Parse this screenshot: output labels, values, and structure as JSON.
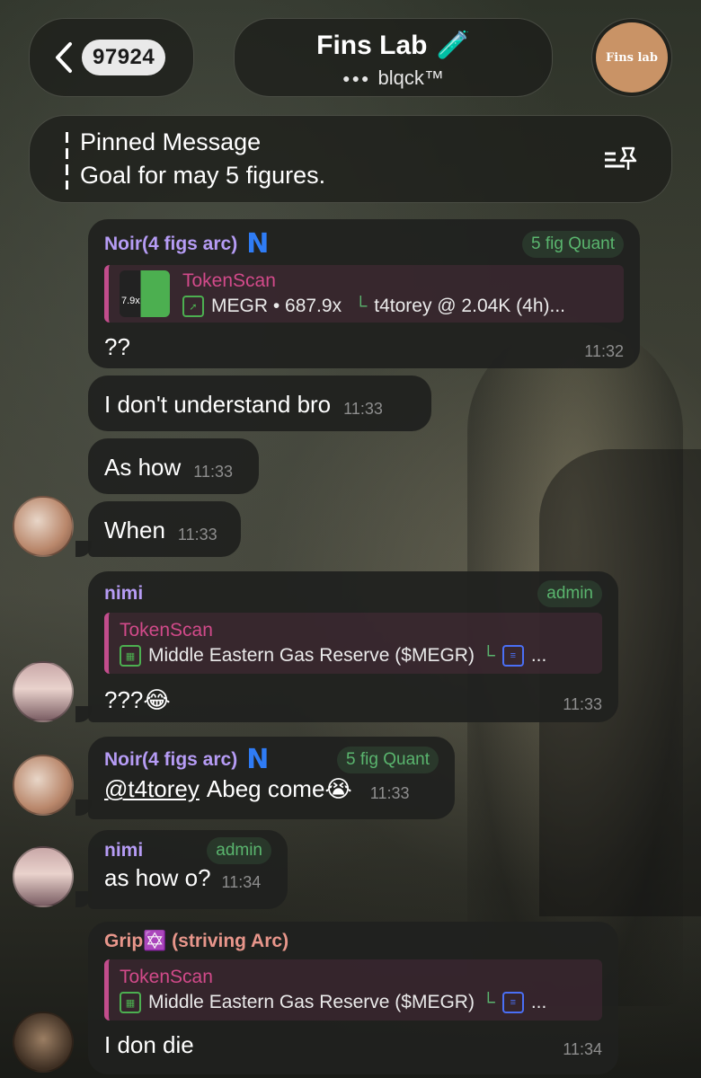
{
  "header": {
    "back_count": "97924",
    "title": "Fins Lab",
    "title_emoji": "🧪",
    "subtitle": "blqck™",
    "group_avatar_text": "Fins lab"
  },
  "pinned": {
    "title": "Pinned Message",
    "text": "Goal for may 5 figures."
  },
  "messages": [
    {
      "sender": "Noir(4 figs arc)",
      "tag": "5 fig Quant",
      "reply_title": "TokenScan",
      "reply_body": "MEGR • 687.9x",
      "reply_extra": "t4torey @ 2.04K (4h)...",
      "thumb_label": "7.9x",
      "text": "??",
      "time": "11:32"
    },
    {
      "text": "I don't understand bro",
      "time": "11:33"
    },
    {
      "text": "As how",
      "time": "11:33"
    },
    {
      "text": "When",
      "time": "11:33"
    },
    {
      "sender": "nimi",
      "tag": "admin",
      "reply_title": "TokenScan",
      "reply_body": "Middle Eastern Gas Reserve ($MEGR)",
      "text": "???😂",
      "time": "11:33"
    },
    {
      "sender": "Noir(4 figs arc)",
      "tag": "5 fig Quant",
      "mention": "@t4torey",
      "text": "Abeg come😭",
      "time": "11:33"
    },
    {
      "sender": "nimi",
      "tag": "admin",
      "text": "as how o?",
      "time": "11:34"
    },
    {
      "sender": "Grip✡️ (striving Arc)",
      "reply_title": "TokenScan",
      "reply_body": "Middle Eastern Gas Reserve ($MEGR)",
      "text": "I don die",
      "time": "11:34"
    }
  ],
  "colors": {
    "sender_purple": "#b69cf5",
    "sender_salmon": "#e8968b",
    "tag_green": "#5ab56e",
    "reply_accent": "#c24d8c",
    "n_logo": "#2f7cf5"
  }
}
